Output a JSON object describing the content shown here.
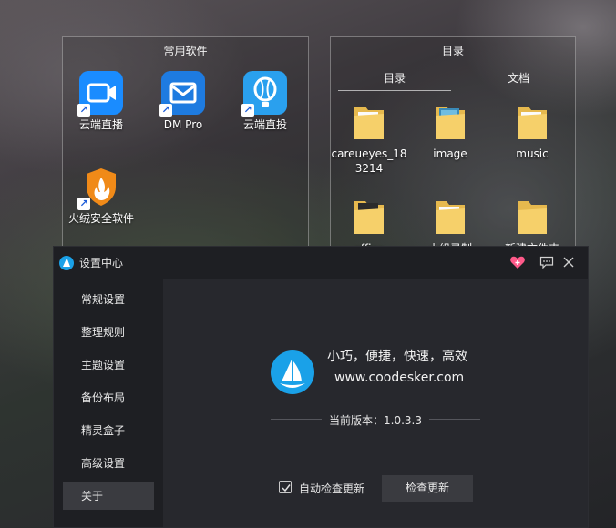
{
  "desktop": {
    "left_panel": {
      "title": "常用软件",
      "apps": [
        {
          "label": "云端直播",
          "icon": "camera-icon",
          "color": "#1a8cff"
        },
        {
          "label": "DM Pro",
          "icon": "mail-icon",
          "color": "#1e7be0"
        },
        {
          "label": "云端直投",
          "icon": "balloon-icon",
          "color": "#2aa0ee"
        },
        {
          "label": "火绒安全软件",
          "icon": "huorong-shield-icon",
          "color": "#f08a18"
        }
      ]
    },
    "right_panel": {
      "title": "目录",
      "tabs": [
        {
          "label": "目录",
          "active": true
        },
        {
          "label": "文档",
          "active": false
        }
      ],
      "folders": [
        {
          "label": "careueyes_183214"
        },
        {
          "label": "image"
        },
        {
          "label": "music"
        },
        {
          "label": "office"
        },
        {
          "label": "小组录制"
        },
        {
          "label": "新建文件夹"
        }
      ]
    }
  },
  "settings": {
    "title": "设置中心",
    "nav": [
      {
        "label": "常规设置",
        "active": false
      },
      {
        "label": "整理规则",
        "active": false
      },
      {
        "label": "主题设置",
        "active": false
      },
      {
        "label": "备份布局",
        "active": false
      },
      {
        "label": "精灵盒子",
        "active": false
      },
      {
        "label": "高级设置",
        "active": false
      },
      {
        "label": "关于",
        "active": true
      }
    ],
    "about": {
      "slogan": "小巧，便捷，快速，高效",
      "website": "www.coodesker.com",
      "version": "当前版本：1.0.3.3",
      "auto_check_label": "自动检查更新",
      "auto_check_checked": true,
      "check_update_label": "检查更新"
    },
    "colors": {
      "accent": "#1aa1e8",
      "heart": "#ff5a8a"
    }
  }
}
